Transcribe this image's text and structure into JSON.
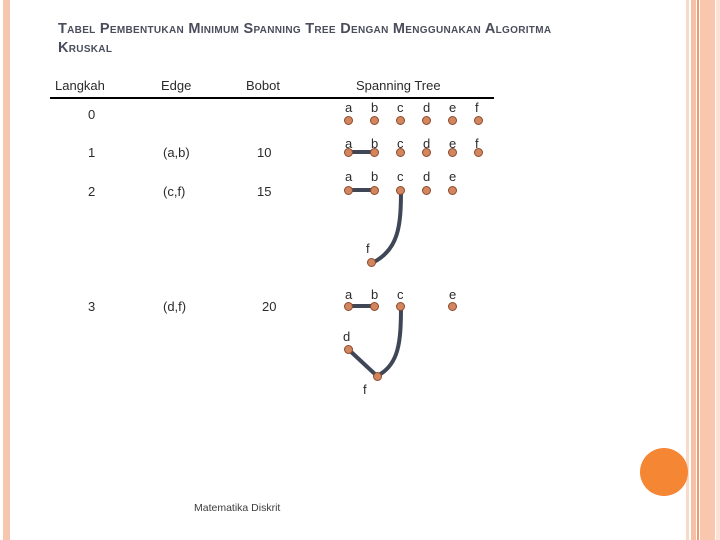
{
  "slide": {
    "title": "Tabel Pembentukan Minimum Spanning Tree Dengan Menggunakan Algoritma Kruskal",
    "footer": "Matematika Diskrit",
    "accent_orange": "#F58634",
    "node_fill": "#D2855E",
    "edge_color": "#3F4756",
    "title_color": "#4A4D5B"
  },
  "table": {
    "headers": {
      "step": "Langkah",
      "edge": "Edge",
      "weight": "Bobot",
      "tree": "Spanning Tree"
    },
    "rows": [
      {
        "step": "0",
        "edge": "",
        "weight": ""
      },
      {
        "step": "1",
        "edge": "(a,b)",
        "weight": "10"
      },
      {
        "step": "2",
        "edge": "(c,f)",
        "weight": "15"
      },
      {
        "step": "3",
        "edge": "(d,f)",
        "weight": "20"
      }
    ]
  },
  "graphs": {
    "row0": {
      "labels": [
        "a",
        "b",
        "c",
        "d",
        "e",
        "f"
      ],
      "edges": []
    },
    "row1": {
      "labels": [
        "a",
        "b",
        "c",
        "d",
        "e",
        "f"
      ],
      "edges": [
        "a-b"
      ]
    },
    "row2": {
      "labels": [
        "a",
        "b",
        "c",
        "d",
        "e",
        "f"
      ],
      "edges": [
        "a-b",
        "c-f"
      ]
    },
    "row3": {
      "labels": [
        "a",
        "b",
        "c",
        "e",
        "d",
        "f"
      ],
      "edges": [
        "a-b",
        "c-f",
        "d-f"
      ]
    }
  },
  "node_labels": {
    "a": "a",
    "b": "b",
    "c": "c",
    "d": "d",
    "e": "e",
    "f": "f"
  }
}
